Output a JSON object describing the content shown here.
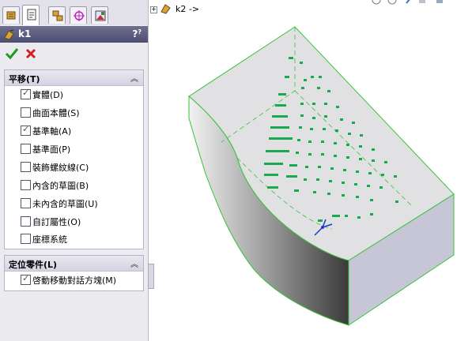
{
  "tabs": [
    {
      "name": "feature-manager"
    },
    {
      "name": "property-manager"
    },
    {
      "name": "configuration-manager"
    },
    {
      "name": "dimxpert-manager"
    },
    {
      "name": "display-manager"
    }
  ],
  "panel": {
    "title": "k1",
    "help_label": "?",
    "help_extra": "?"
  },
  "group_translate": {
    "title": "平移(T)",
    "items": [
      {
        "label": "實體(D)",
        "checked": true
      },
      {
        "label": "曲面本體(S)",
        "checked": false
      },
      {
        "label": "基準軸(A)",
        "checked": true
      },
      {
        "label": "基準面(P)",
        "checked": false
      },
      {
        "label": "裝飾螺紋線(C)",
        "checked": false
      },
      {
        "label": "內含的草圖(B)",
        "checked": false
      },
      {
        "label": "未內含的草圖(U)",
        "checked": false
      },
      {
        "label": "自訂屬性(O)",
        "checked": false
      },
      {
        "label": "座標系統",
        "checked": false
      }
    ]
  },
  "group_position": {
    "title": "定位零件(L)",
    "items": [
      {
        "label": "啓動移動對話方塊(M)",
        "checked": true
      }
    ]
  },
  "tree": {
    "label": "k2 ->"
  },
  "colors": {
    "accent_green": "#22aa55",
    "title_bar": "#5a5a80"
  }
}
